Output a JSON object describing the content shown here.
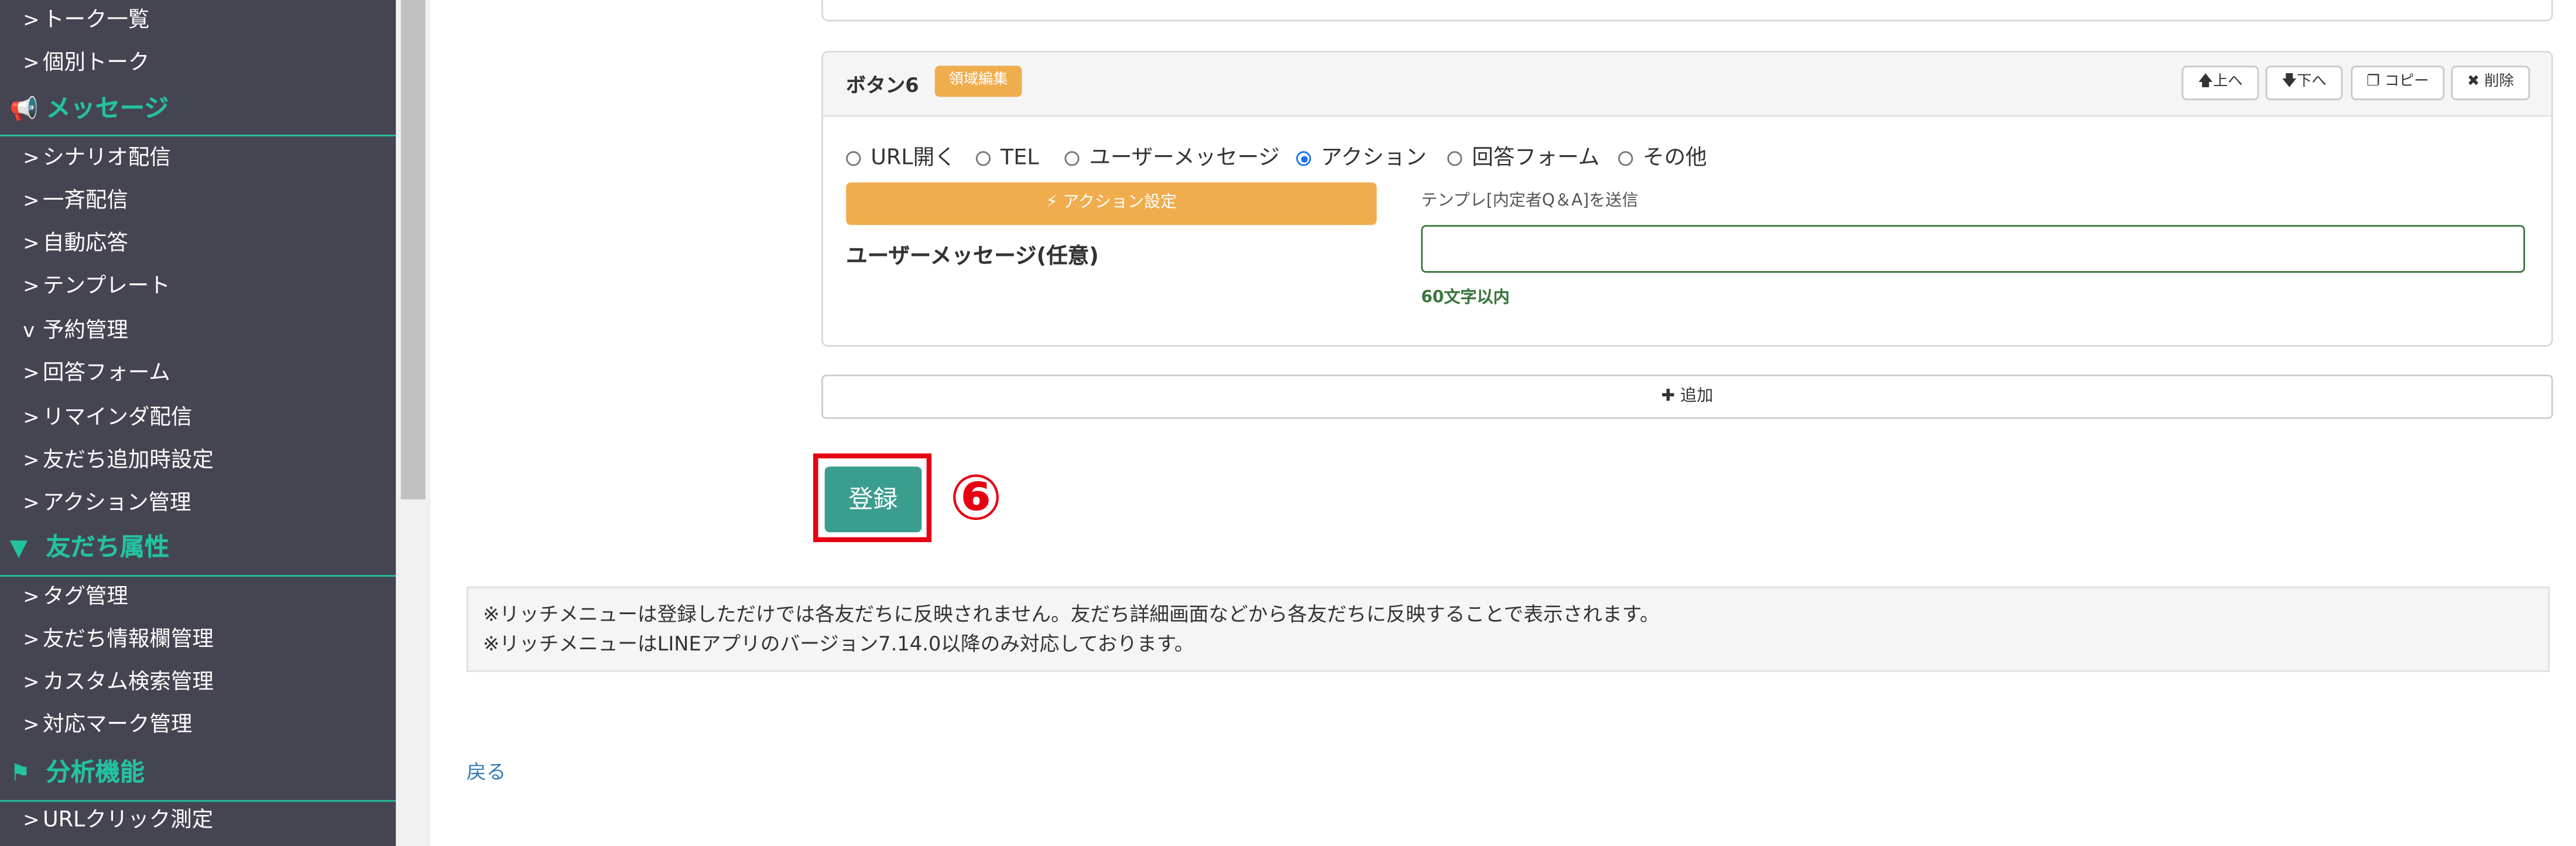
{
  "sidebar": {
    "items_top": [
      {
        "chev": ">",
        "label": "トーク一覧"
      },
      {
        "chev": ">",
        "label": "個別トーク"
      }
    ],
    "section_message": {
      "icon": "megaphone-icon",
      "glyph": "📢",
      "label": "メッセージ"
    },
    "items_message": [
      {
        "chev": ">",
        "label": "シナリオ配信"
      },
      {
        "chev": ">",
        "label": "一斉配信"
      },
      {
        "chev": ">",
        "label": "自動応答"
      },
      {
        "chev": ">",
        "label": "テンプレート"
      },
      {
        "chev": "v",
        "label": "予約管理"
      },
      {
        "chev": ">",
        "label": "回答フォーム"
      },
      {
        "chev": ">",
        "label": "リマインダ配信"
      },
      {
        "chev": ">",
        "label": "友だち追加時設定"
      },
      {
        "chev": ">",
        "label": "アクション管理"
      }
    ],
    "section_friends": {
      "icon": "filter-icon",
      "glyph": "▼",
      "label": "友だち属性"
    },
    "items_friends": [
      {
        "chev": ">",
        "label": "タグ管理"
      },
      {
        "chev": ">",
        "label": "友だち情報欄管理"
      },
      {
        "chev": ">",
        "label": "カスタム検索管理"
      },
      {
        "chev": ">",
        "label": "対応マーク管理"
      }
    ],
    "section_analysis": {
      "icon": "flag-icon",
      "glyph": "⚑",
      "label": "分析機能"
    },
    "items_analysis": [
      {
        "chev": ">",
        "label": "URLクリック測定"
      }
    ]
  },
  "card": {
    "title": "ボタン6",
    "badge": "領域編集",
    "up": "上へ",
    "down": "下へ",
    "copy": "コピー",
    "delete": "削除",
    "radios": [
      {
        "label": "URL開く",
        "checked": false
      },
      {
        "label": "TEL",
        "checked": false
      },
      {
        "label": "ユーザーメッセージ",
        "checked": false
      },
      {
        "label": "アクション",
        "checked": true
      },
      {
        "label": "回答フォーム",
        "checked": false
      },
      {
        "label": "その他",
        "checked": false
      }
    ],
    "action_button": "アクション設定",
    "action_hint": "テンプレ[内定者Q＆A]を送信",
    "user_message_label": "ユーザーメッセージ(任意)",
    "user_message_value": "",
    "user_message_help": "60文字以内"
  },
  "add_button": "追加",
  "submit_button": "登録",
  "annotation_number": "⑥",
  "notice": [
    "※リッチメニューは登録しただけでは各友だちに反映されません。友だち詳細画面などから各友だちに反映することで表示されます。",
    "※リッチメニューはLINEアプリのバージョン7.14.0以降のみ対応しております。"
  ],
  "back_link": "戻る",
  "colors": {
    "sidebar_bg": "#454552",
    "accent_green": "#23c3a0",
    "warning_orange": "#f0ad4e",
    "submit_teal": "#3a9e8f",
    "annotation_red": "#e60012"
  }
}
